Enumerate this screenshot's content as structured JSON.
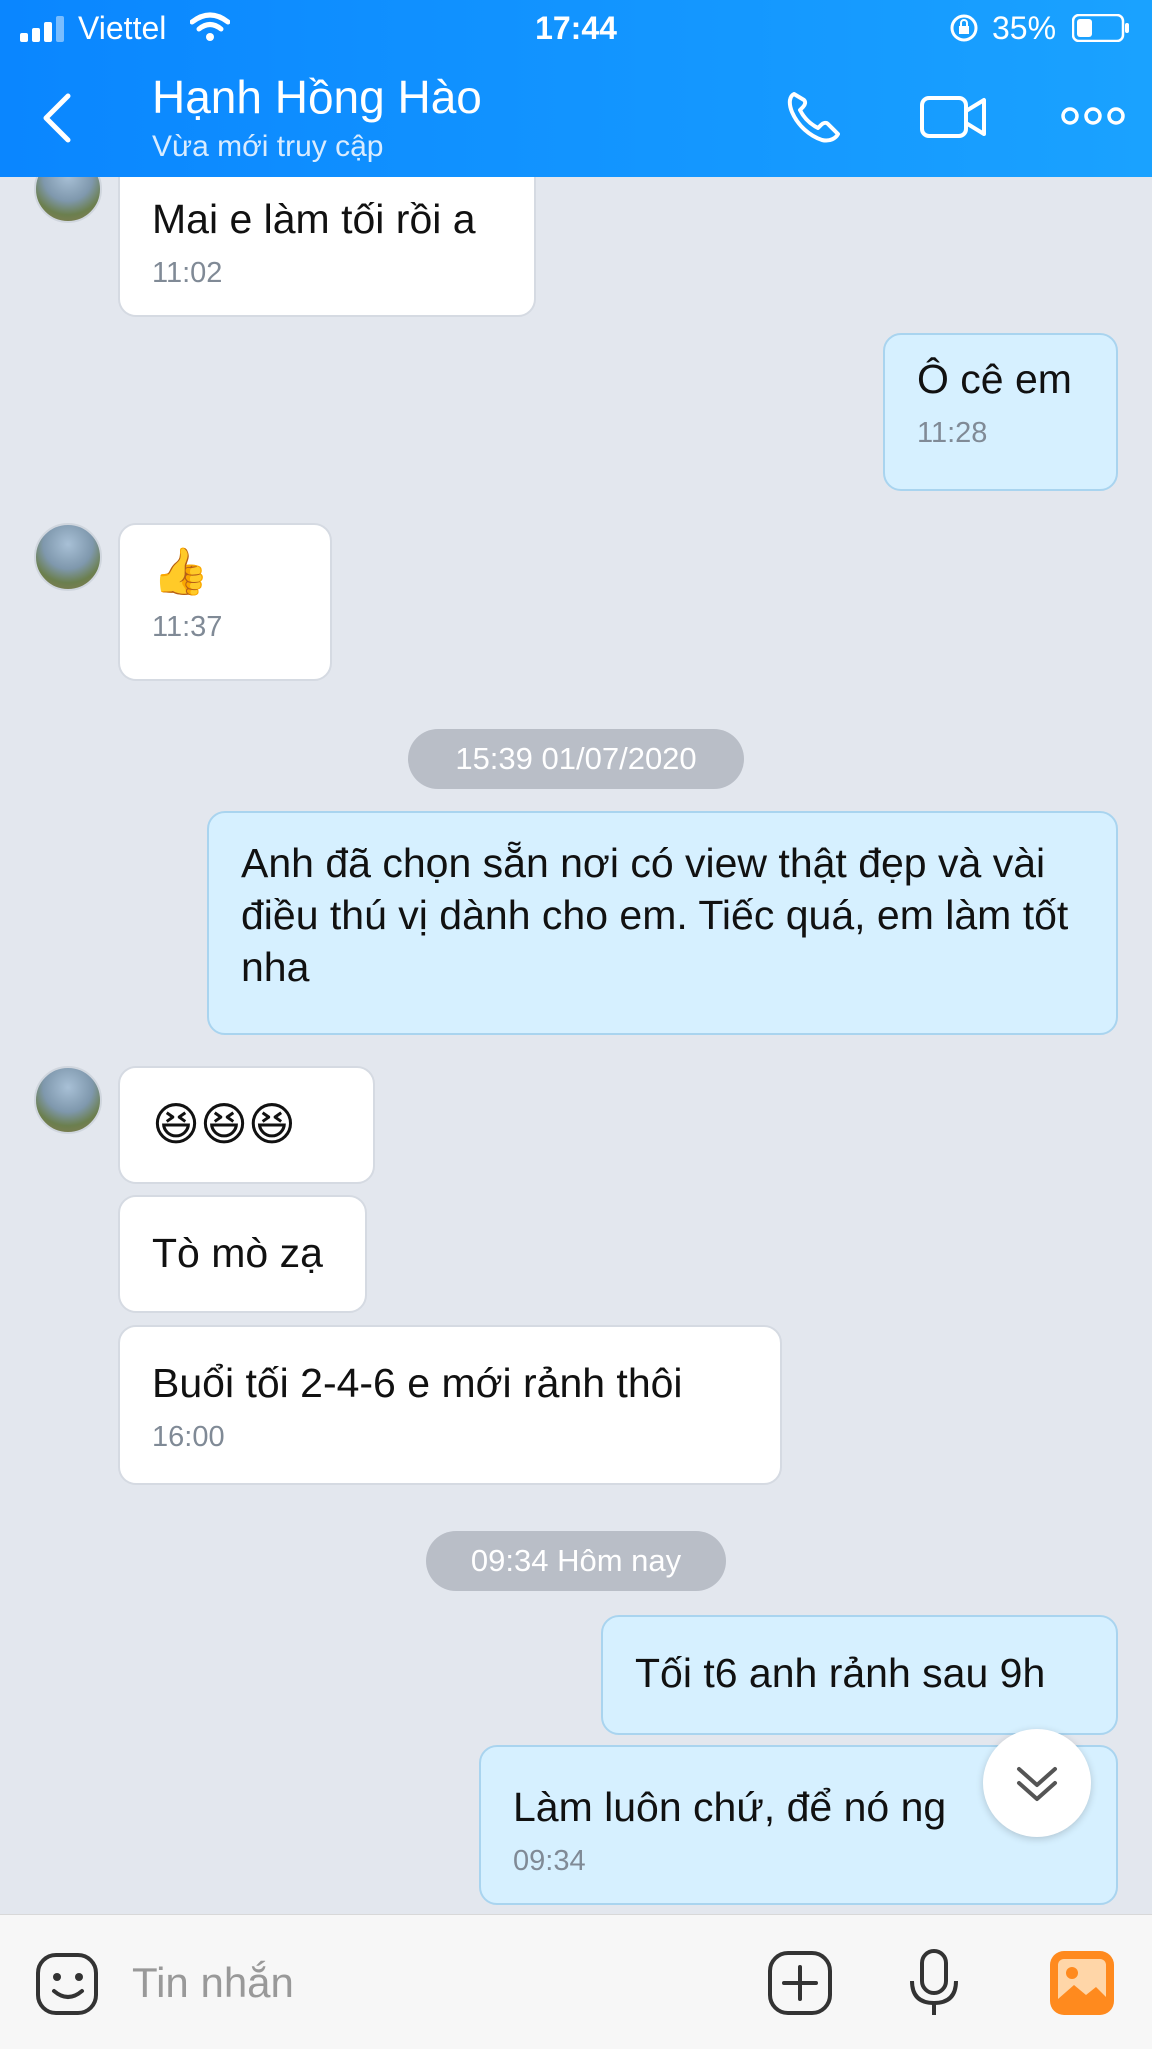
{
  "status_bar": {
    "carrier": "Viettel",
    "time": "17:44",
    "battery": "35%"
  },
  "header": {
    "title": "Hạnh Hồng Hào",
    "subtitle": "Vừa mới truy cập"
  },
  "messages": [
    {
      "dir": "in",
      "text": "Mai e làm tối rồi a",
      "time": "11:02"
    },
    {
      "dir": "out",
      "text": "Ô cê em",
      "time": "11:28"
    },
    {
      "dir": "in",
      "text": "👍",
      "time": "11:37"
    },
    {
      "type": "separator",
      "text": "15:39 01/07/2020"
    },
    {
      "dir": "out",
      "text": "Anh đã chọn sẵn nơi có view thật đẹp và vài điều thú vị dành cho em. Tiếc quá, em làm tốt nha"
    },
    {
      "dir": "in",
      "text": "😆😆😆"
    },
    {
      "dir": "in",
      "text": "Tò mò zạ"
    },
    {
      "dir": "in",
      "text": "Buổi tối 2-4-6 e mới rảnh thôi",
      "time": "16:00"
    },
    {
      "type": "separator",
      "text": "09:34 Hôm nay"
    },
    {
      "dir": "out",
      "text": "Tối t6 anh rảnh sau 9h"
    },
    {
      "dir": "out",
      "text": "Làm luôn chứ, để nó ng",
      "time": "09:34"
    }
  ],
  "input": {
    "placeholder": "Tin nhắn"
  },
  "colors": {
    "header": "#0a86ff",
    "incoming": "#ffffff",
    "outgoing": "#d6f0ff",
    "background": "#e3e7ee"
  }
}
